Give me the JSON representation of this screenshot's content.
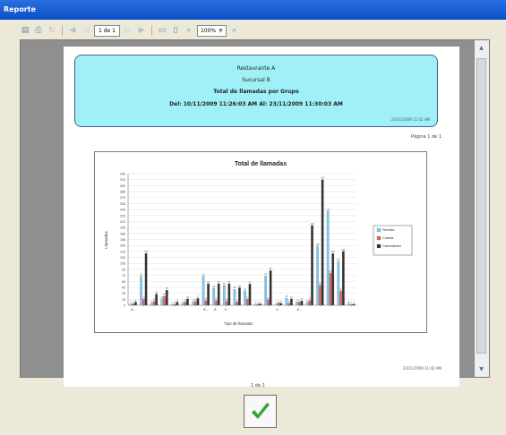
{
  "window": {
    "title": "Reporte"
  },
  "toolbar": {
    "page_indicator": "1 de 1",
    "zoom_value": "100%"
  },
  "report": {
    "restaurant": "Restaurante A",
    "branch": "Sucursal B",
    "title": "Total de llamadas por Grupo",
    "date_range": "Del: 10/11/2009 11:26:03 AM     Al: 23/11/2009 11:30:03 AM",
    "header_timestamp": "23/11/2009 11:42 AM",
    "page_number": "Página 1 de 1",
    "footer_timestamp": "23/11/2009 11:42 AM"
  },
  "viewer": {
    "page_status": "1 de 1"
  },
  "colors": {
    "series_servicio": "#7ec8f0",
    "series_cuenta": "#e26060",
    "series_cancelacion": "#333333",
    "header_bg": "#a0f0f7",
    "ok_check": "#2ea82e"
  },
  "chart_data": {
    "type": "bar",
    "title": "Total de llamadas",
    "xlabel": "Tipo de llamada",
    "ylabel": "Llamadas",
    "ylim": [
      0,
      330
    ],
    "yticks": [
      0,
      15,
      30,
      45,
      60,
      75,
      90,
      105,
      120,
      135,
      150,
      165,
      180,
      195,
      210,
      225,
      240,
      255,
      270,
      285,
      300,
      315,
      330
    ],
    "legend_position": "right",
    "grid": true,
    "categories": [
      "A...",
      "",
      "",
      "",
      "",
      "",
      "",
      "B...",
      "S...",
      "V...",
      "",
      "",
      "",
      "",
      "C...",
      "",
      "D...",
      "",
      "",
      "",
      "",
      ""
    ],
    "series": [
      {
        "name": "Servicio",
        "values": [
          4,
          73,
          5,
          16,
          2,
          5,
          8,
          73,
          43,
          50,
          40,
          35,
          3,
          74,
          3,
          18,
          8,
          8,
          148,
          235,
          110,
          5
        ]
      },
      {
        "name": "Cuenta",
        "values": [
          4,
          15,
          10,
          22,
          3,
          8,
          10,
          12,
          12,
          10,
          8,
          15,
          3,
          14,
          6,
          5,
          8,
          12,
          50,
          80,
          35,
          2
        ]
      },
      {
        "name": "Cancelación",
        "values": [
          8,
          130,
          28,
          38,
          8,
          16,
          17,
          54,
          54,
          54,
          44,
          53,
          4,
          87,
          5,
          16,
          11,
          200,
          315,
          130,
          135,
          3
        ]
      }
    ]
  }
}
